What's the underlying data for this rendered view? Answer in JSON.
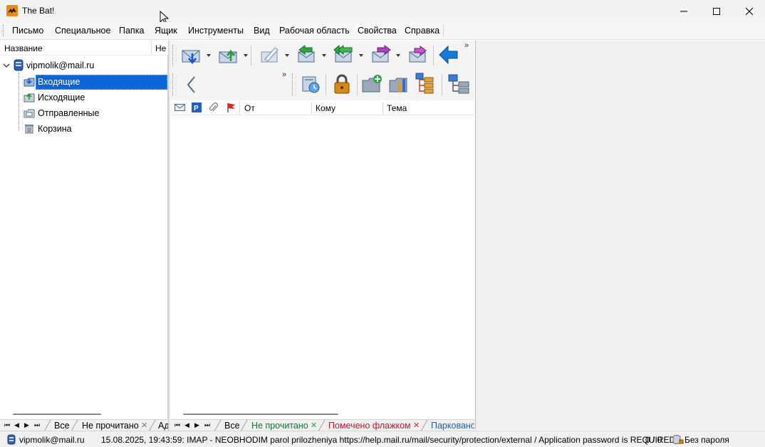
{
  "window": {
    "title": "The Bat!"
  },
  "menu": [
    "Письмо",
    "Специальное",
    "Папка",
    "Ящик",
    "Инструменты",
    "Вид",
    "Рабочая область",
    "Свойства",
    "Справка"
  ],
  "folder_pane": {
    "columns": {
      "name": "Название",
      "unread": "Не"
    },
    "account": "vipmolik@mail.ru",
    "folders": [
      "Входящие",
      "Исходящие",
      "Отправленные",
      "Корзина"
    ],
    "selected": "Входящие"
  },
  "message_list": {
    "columns": {
      "from": "От",
      "to": "Кому",
      "subject": "Тема"
    }
  },
  "folder_tabs": {
    "all": "Все",
    "unread": "Не прочитано",
    "cut": "Ад"
  },
  "list_tabs": {
    "all": "Все",
    "unread": "Не прочитано",
    "flagged": "Помечено флажком",
    "parked": "Парковано"
  },
  "status": {
    "account": "vipmolik@mail.ru",
    "message": "15.08.2025, 19:43:59: IMAP  - NEOBHODIM parol prilozheniya https://help.mail.ru/mail/security/protection/external / Application password is REQUIRED",
    "counter": "0 / 0",
    "password": "Без пароля"
  },
  "colors": {
    "selection": "#0a64d7",
    "tab_unread": "#0d7a2c",
    "tab_flagged": "#c2182b",
    "tab_parked": "#1e63a8"
  }
}
